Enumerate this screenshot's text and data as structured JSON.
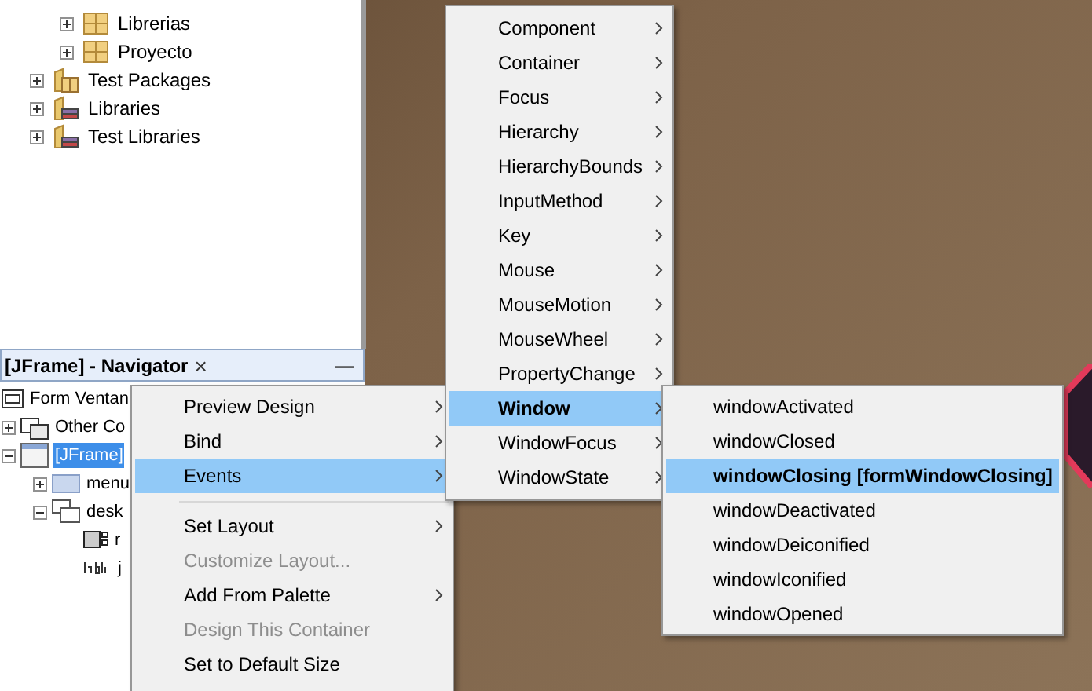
{
  "project_tree": [
    {
      "label": "Librerias",
      "kind": "package",
      "expanded": false,
      "nested": true
    },
    {
      "label": "Proyecto",
      "kind": "package",
      "expanded": false,
      "nested": true
    },
    {
      "label": "Test Packages",
      "kind": "folder-package",
      "expanded": false,
      "nested": false
    },
    {
      "label": "Libraries",
      "kind": "folder-library",
      "expanded": false,
      "nested": false
    },
    {
      "label": "Test Libraries",
      "kind": "folder-library",
      "expanded": false,
      "nested": false
    }
  ],
  "navigator": {
    "title": "[JFrame] - Navigator",
    "close": "×",
    "minimize": "—",
    "tree": [
      {
        "label": "Form Ventan",
        "kind": "form",
        "selected": false
      },
      {
        "label": "Other Co",
        "kind": "components",
        "selected": false,
        "expanded": false
      },
      {
        "label": "[JFrame]",
        "kind": "frame",
        "selected": true,
        "expanded": true,
        "children": [
          {
            "label": "menu",
            "kind": "file",
            "selected": false,
            "expanded": false
          },
          {
            "label": "desk",
            "kind": "desktop",
            "selected": false,
            "expanded": true,
            "children": [
              {
                "label": "r",
                "kind": "grid",
                "selected": false
              },
              {
                "label": "j",
                "kind": "label",
                "selected": false
              }
            ]
          }
        ]
      }
    ]
  },
  "context_menu": [
    {
      "kind": "item",
      "label": "Preview Design",
      "submenu": true,
      "disabled": false,
      "selected": false
    },
    {
      "kind": "item",
      "label": "Bind",
      "submenu": true,
      "disabled": false,
      "selected": false
    },
    {
      "kind": "item",
      "label": "Events",
      "submenu": true,
      "disabled": false,
      "selected": true
    },
    {
      "kind": "separator"
    },
    {
      "kind": "item",
      "label": "Set Layout",
      "submenu": true,
      "disabled": false,
      "selected": false
    },
    {
      "kind": "item",
      "label": "Customize Layout...",
      "submenu": false,
      "disabled": true,
      "selected": false
    },
    {
      "kind": "item",
      "label": "Add From Palette",
      "submenu": true,
      "disabled": false,
      "selected": false
    },
    {
      "kind": "item",
      "label": "Design This Container",
      "submenu": false,
      "disabled": true,
      "selected": false
    },
    {
      "kind": "item",
      "label": "Set to Default Size",
      "submenu": false,
      "disabled": false,
      "selected": false
    }
  ],
  "events_menu": [
    {
      "label": "Component",
      "bold": false,
      "selected": false
    },
    {
      "label": "Container",
      "bold": false,
      "selected": false
    },
    {
      "label": "Focus",
      "bold": false,
      "selected": false
    },
    {
      "label": "Hierarchy",
      "bold": false,
      "selected": false
    },
    {
      "label": "HierarchyBounds",
      "bold": false,
      "selected": false
    },
    {
      "label": "InputMethod",
      "bold": false,
      "selected": false
    },
    {
      "label": "Key",
      "bold": false,
      "selected": false
    },
    {
      "label": "Mouse",
      "bold": false,
      "selected": false
    },
    {
      "label": "MouseMotion",
      "bold": false,
      "selected": false
    },
    {
      "label": "MouseWheel",
      "bold": false,
      "selected": false
    },
    {
      "label": "PropertyChange",
      "bold": false,
      "selected": false
    },
    {
      "label": "Window",
      "bold": true,
      "selected": true
    },
    {
      "label": "WindowFocus",
      "bold": false,
      "selected": false
    },
    {
      "label": "WindowState",
      "bold": false,
      "selected": false
    }
  ],
  "window_menu": [
    {
      "label": "windowActivated",
      "bold": false,
      "selected": false
    },
    {
      "label": "windowClosed",
      "bold": false,
      "selected": false
    },
    {
      "label": "windowClosing [formWindowClosing]",
      "bold": true,
      "selected": true
    },
    {
      "label": "windowDeactivated",
      "bold": false,
      "selected": false
    },
    {
      "label": "windowDeiconified",
      "bold": false,
      "selected": false
    },
    {
      "label": "windowIconified",
      "bold": false,
      "selected": false
    },
    {
      "label": "windowOpened",
      "bold": false,
      "selected": false
    }
  ]
}
